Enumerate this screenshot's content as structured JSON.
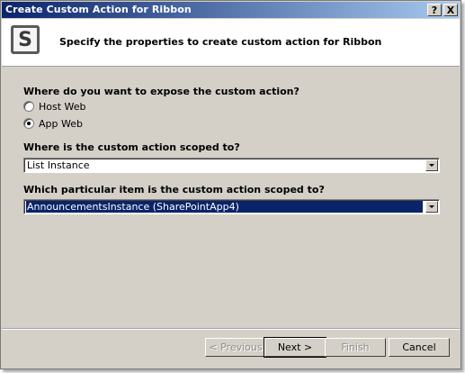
{
  "window": {
    "title": "Create Custom Action for Ribbon",
    "help_label": "?",
    "close_label": "X"
  },
  "header": {
    "logo_letter": "S",
    "text": "Specify the properties to create custom action for Ribbon"
  },
  "expose": {
    "question": "Where do you want to expose the custom action?",
    "options": [
      {
        "label": "Host Web",
        "checked": false
      },
      {
        "label": "App Web",
        "checked": true
      }
    ]
  },
  "scope": {
    "question": "Where is the custom action scoped to?",
    "value": "List Instance"
  },
  "item": {
    "question": "Which particular item is the custom action scoped to?",
    "value": "AnnouncementsInstance (SharePointApp4)"
  },
  "buttons": {
    "previous": "< Previous",
    "next": "Next >",
    "finish": "Finish",
    "cancel": "Cancel"
  }
}
